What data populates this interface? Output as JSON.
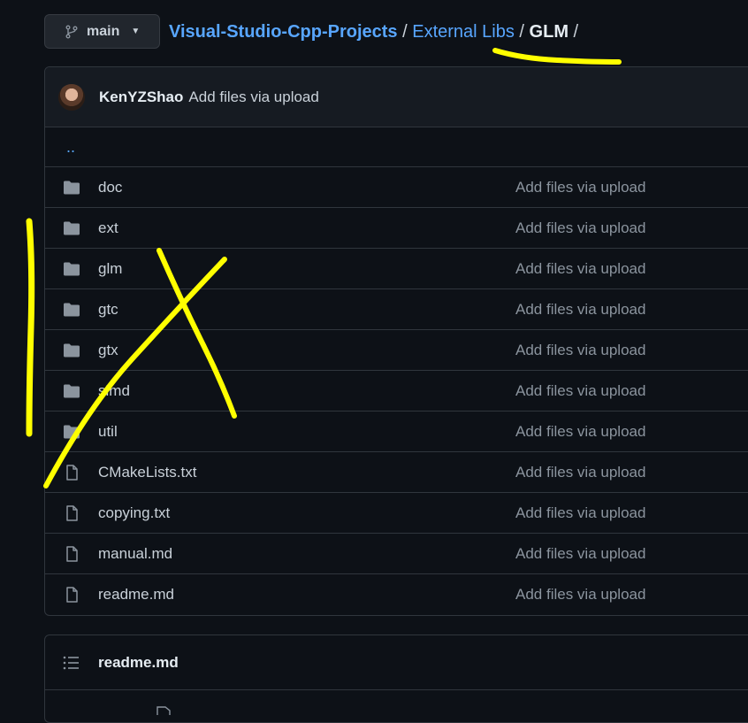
{
  "branch": {
    "name": "main",
    "icon": "git-branch-icon"
  },
  "breadcrumb": {
    "repo": "Visual-Studio-Cpp-Projects",
    "sep1": "/",
    "folder": "External Libs",
    "sep2": "/",
    "current": "GLM",
    "sep3": "/"
  },
  "commit": {
    "author": "KenYZShao",
    "message": "Add files via upload"
  },
  "parent_link": "..",
  "files": [
    {
      "name": "doc",
      "type": "folder",
      "message": "Add files via upload"
    },
    {
      "name": "ext",
      "type": "folder",
      "message": "Add files via upload"
    },
    {
      "name": "glm",
      "type": "folder",
      "message": "Add files via upload"
    },
    {
      "name": "gtc",
      "type": "folder",
      "message": "Add files via upload"
    },
    {
      "name": "gtx",
      "type": "folder",
      "message": "Add files via upload"
    },
    {
      "name": "simd",
      "type": "folder",
      "message": "Add files via upload"
    },
    {
      "name": "util",
      "type": "folder",
      "message": "Add files via upload"
    },
    {
      "name": "CMakeLists.txt",
      "type": "file",
      "message": "Add files via upload"
    },
    {
      "name": "copying.txt",
      "type": "file",
      "message": "Add files via upload"
    },
    {
      "name": "manual.md",
      "type": "file",
      "message": "Add files via upload"
    },
    {
      "name": "readme.md",
      "type": "file",
      "message": "Add files via upload"
    }
  ],
  "readme": {
    "title": "readme.md",
    "icon": "list-icon"
  },
  "colors": {
    "background": "#0d1117",
    "link": "#58a6ff",
    "muted": "#8b949e",
    "border": "#30363d",
    "annotation": "#ffff00"
  }
}
